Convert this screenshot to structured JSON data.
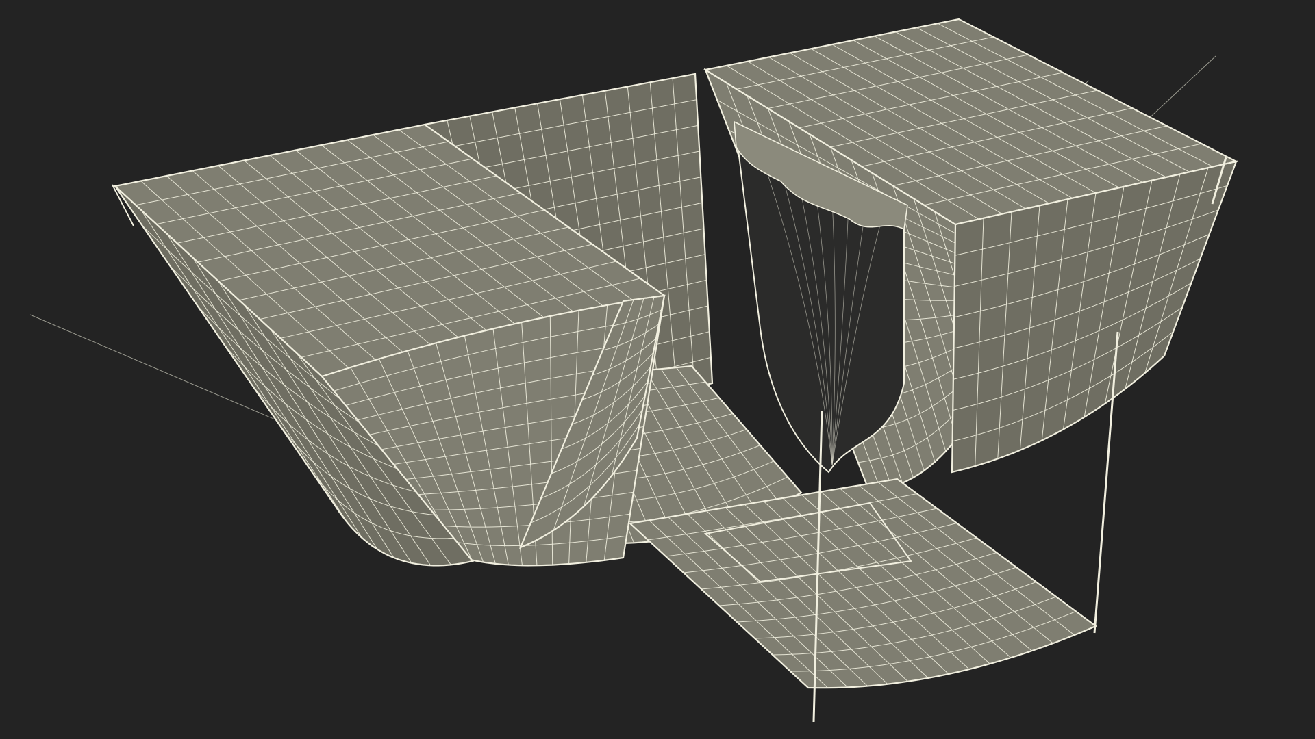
{
  "viewport": {
    "background": "#232323",
    "surface_fill": "#7f7e71",
    "surface_fill_dark": "#6f6e62",
    "interior_fill": "#2b2b2a",
    "wire_color": "#f1efdf",
    "guide_color": "#9a9a8f"
  },
  "model": {
    "render_mode": "wireframe-on-shaded",
    "object": "stage-box-with-curtains"
  }
}
